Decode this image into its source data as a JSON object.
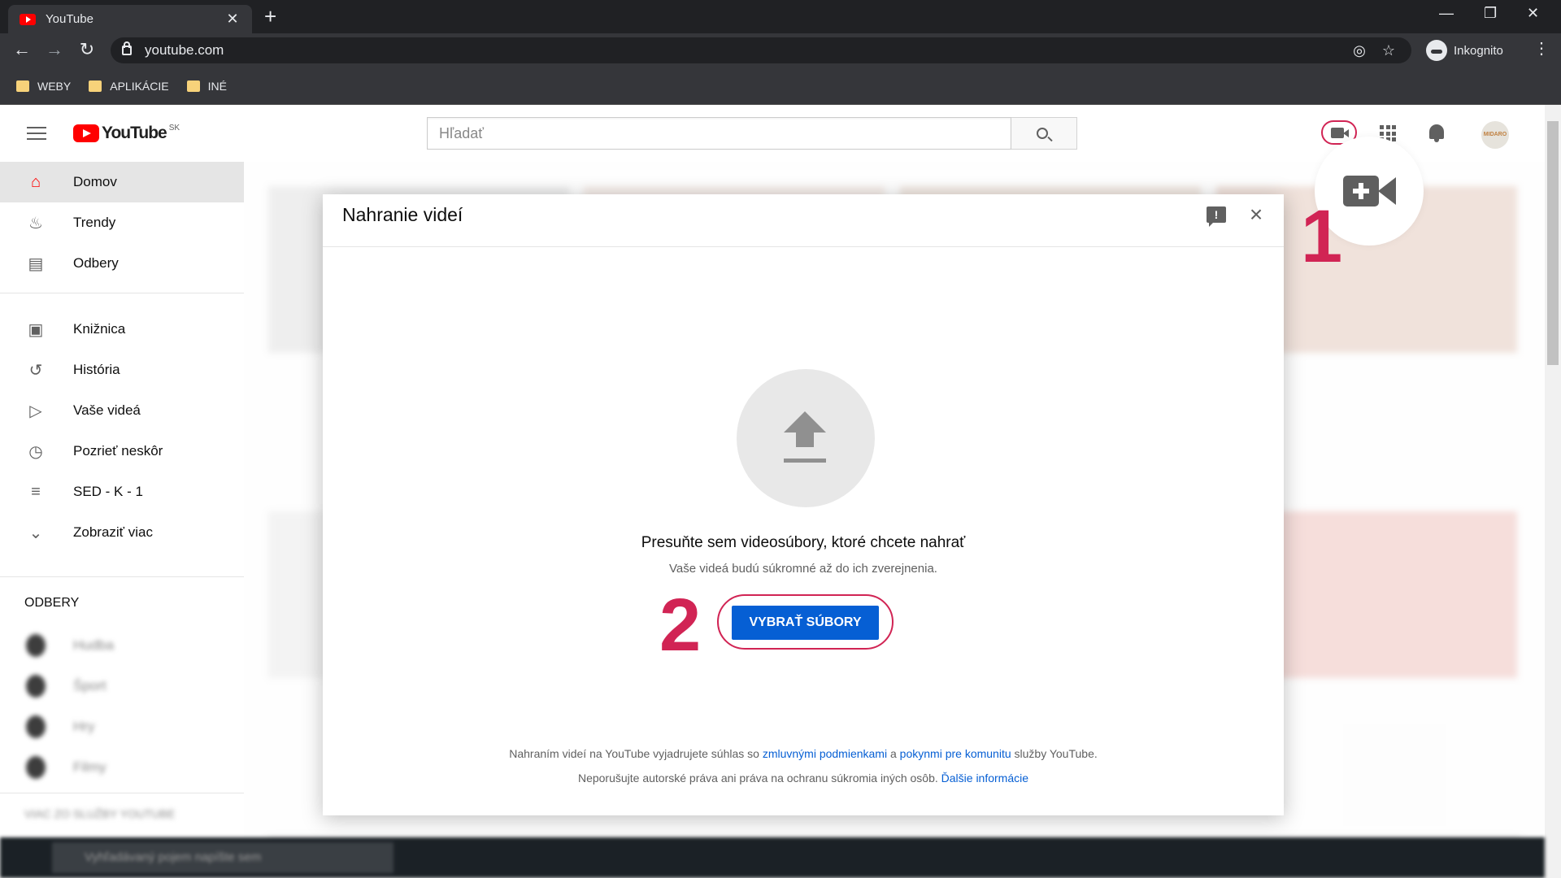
{
  "browser": {
    "tab_title": "YouTube",
    "url": "youtube.com",
    "profile": "Inkognito",
    "bookmarks": [
      "WEBY",
      "APLIKÁCIE",
      "INÉ"
    ]
  },
  "masthead": {
    "logo_text": "YouTube",
    "region": "SK",
    "search_placeholder": "Hľadať",
    "avatar_text": "MIDARO"
  },
  "sidebar": {
    "items": [
      {
        "label": "Domov",
        "icon": "home-icon"
      },
      {
        "label": "Trendy",
        "icon": "flame-icon"
      },
      {
        "label": "Odbery",
        "icon": "subscriptions-icon"
      },
      {
        "label": "Knižnica",
        "icon": "library-icon"
      },
      {
        "label": "História",
        "icon": "history-icon"
      },
      {
        "label": "Vaše videá",
        "icon": "your-videos-icon"
      },
      {
        "label": "Pozrieť neskôr",
        "icon": "clock-icon"
      },
      {
        "label": "SED - K - 1",
        "icon": "playlist-icon"
      },
      {
        "label": "Zobraziť viac",
        "icon": "chevron-down-icon"
      }
    ],
    "section_title": "ODBERY",
    "subscriptions": [
      "Hudba",
      "Šport",
      "Hry",
      "Filmy"
    ],
    "more_title": "VIAC ZO SLUŽBY YOUTUBE"
  },
  "dialog": {
    "title": "Nahranie videí",
    "drag_text": "Presuňte sem videosúbory, ktoré chcete nahrať",
    "private_text": "Vaše videá budú súkromné až do ich zverejnenia.",
    "select_button": "VYBRAŤ SÚBORY",
    "legal_1_pre": "Nahraním videí na YouTube vyjadrujete súhlas so",
    "legal_1_link1": "zmluvnými podmienkami",
    "legal_1_mid": "a",
    "legal_1_link2": "pokynmi pre komunitu",
    "legal_1_post": "služby YouTube.",
    "legal_2_pre": "Neporušujte autorské práva ani práva na ochranu súkromia iných osôb.",
    "legal_2_link": "Ďalšie informácie"
  },
  "annotations": {
    "step1": "1",
    "step2": "2"
  },
  "taskbar": {
    "search_placeholder": "Vyhľadávaný pojem napíšte sem"
  },
  "colors": {
    "accent": "#d12454",
    "primary_button": "#065fd4",
    "youtube_red": "#ff0000"
  }
}
